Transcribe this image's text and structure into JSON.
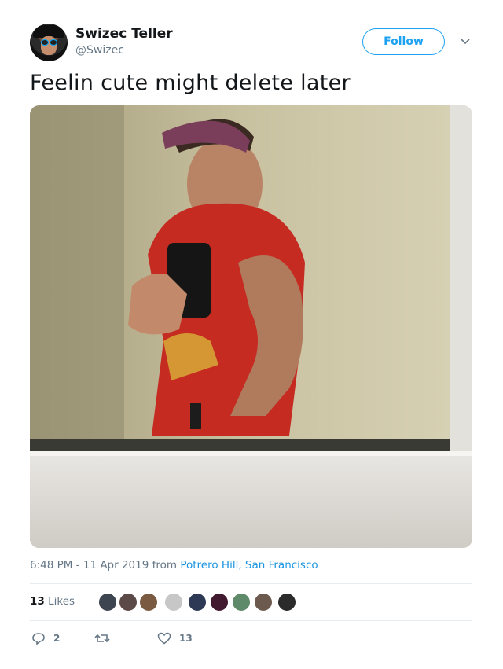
{
  "author": {
    "name": "Swizec Teller",
    "handle": "@Swizec"
  },
  "follow_label": "Follow",
  "tweet": {
    "text": "Feelin cute might delete later",
    "timestamp": "6:48 PM - 11 Apr 2019",
    "from_label": "from",
    "place": "Potrero Hill, San Francisco"
  },
  "likes": {
    "count": "13",
    "label": "Likes"
  },
  "actions": {
    "replies": "2",
    "retweets": "",
    "likes": "13"
  },
  "colors": {
    "accent": "#1da1f2",
    "text": "#14171a",
    "muted": "#657786",
    "divider": "#e6ecf0"
  },
  "icons": [
    "chevron-down-icon",
    "reply-icon",
    "retweet-icon",
    "heart-icon"
  ]
}
